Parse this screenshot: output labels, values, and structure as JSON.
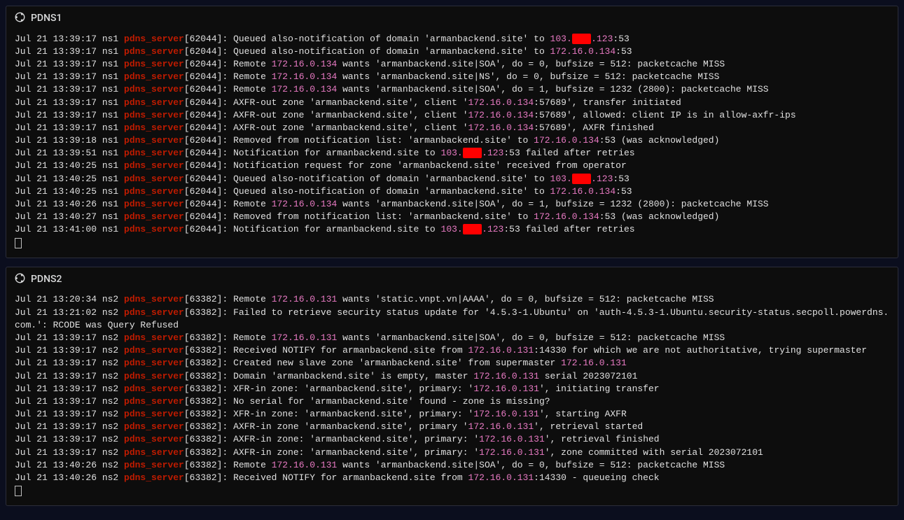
{
  "panel1": {
    "title": "PDNS1",
    "lines": [
      {
        "segments": [
          {
            "t": "Jul 21 13:39:17 ns1 ",
            "c": "ts"
          },
          {
            "t": "pdns_server",
            "c": "proc"
          },
          {
            "t": "[62044]: Queued also-notification of domain 'armanbackend.site' to ",
            "c": "pid"
          },
          {
            "t": "103.",
            "c": "ip"
          },
          {
            "t": "XXX",
            "c": "redact"
          },
          {
            "t": ".123",
            "c": "ip"
          },
          {
            "t": ":53",
            "c": "pid"
          }
        ]
      },
      {
        "segments": [
          {
            "t": "Jul 21 13:39:17 ns1 ",
            "c": "ts"
          },
          {
            "t": "pdns_server",
            "c": "proc"
          },
          {
            "t": "[62044]: Queued also-notification of domain 'armanbackend.site' to ",
            "c": "pid"
          },
          {
            "t": "172.16.0.134",
            "c": "ip"
          },
          {
            "t": ":53",
            "c": "pid"
          }
        ]
      },
      {
        "segments": [
          {
            "t": "Jul 21 13:39:17 ns1 ",
            "c": "ts"
          },
          {
            "t": "pdns_server",
            "c": "proc"
          },
          {
            "t": "[62044]: Remote ",
            "c": "pid"
          },
          {
            "t": "172.16.0.134",
            "c": "ip"
          },
          {
            "t": " wants 'armanbackend.site|SOA', do = 0, bufsize = 512: packetcache MISS",
            "c": "pid"
          }
        ]
      },
      {
        "segments": [
          {
            "t": "Jul 21 13:39:17 ns1 ",
            "c": "ts"
          },
          {
            "t": "pdns_server",
            "c": "proc"
          },
          {
            "t": "[62044]: Remote ",
            "c": "pid"
          },
          {
            "t": "172.16.0.134",
            "c": "ip"
          },
          {
            "t": " wants 'armanbackend.site|NS', do = 0, bufsize = 512: packetcache MISS",
            "c": "pid"
          }
        ]
      },
      {
        "segments": [
          {
            "t": "Jul 21 13:39:17 ns1 ",
            "c": "ts"
          },
          {
            "t": "pdns_server",
            "c": "proc"
          },
          {
            "t": "[62044]: Remote ",
            "c": "pid"
          },
          {
            "t": "172.16.0.134",
            "c": "ip"
          },
          {
            "t": " wants 'armanbackend.site|SOA', do = 1, bufsize = 1232 (2800): packetcache MISS",
            "c": "pid"
          }
        ]
      },
      {
        "segments": [
          {
            "t": "Jul 21 13:39:17 ns1 ",
            "c": "ts"
          },
          {
            "t": "pdns_server",
            "c": "proc"
          },
          {
            "t": "[62044]: AXFR-out zone 'armanbackend.site', client '",
            "c": "pid"
          },
          {
            "t": "172.16.0.134",
            "c": "ipq"
          },
          {
            "t": ":57689', transfer initiated",
            "c": "pid"
          }
        ]
      },
      {
        "segments": [
          {
            "t": "Jul 21 13:39:17 ns1 ",
            "c": "ts"
          },
          {
            "t": "pdns_server",
            "c": "proc"
          },
          {
            "t": "[62044]: AXFR-out zone 'armanbackend.site', client '",
            "c": "pid"
          },
          {
            "t": "172.16.0.134",
            "c": "ipq"
          },
          {
            "t": ":57689', allowed: client IP is in allow-axfr-ips",
            "c": "pid"
          }
        ]
      },
      {
        "segments": [
          {
            "t": "Jul 21 13:39:17 ns1 ",
            "c": "ts"
          },
          {
            "t": "pdns_server",
            "c": "proc"
          },
          {
            "t": "[62044]: AXFR-out zone 'armanbackend.site', client '",
            "c": "pid"
          },
          {
            "t": "172.16.0.134",
            "c": "ipq"
          },
          {
            "t": ":57689', AXFR finished",
            "c": "pid"
          }
        ]
      },
      {
        "segments": [
          {
            "t": "Jul 21 13:39:18 ns1 ",
            "c": "ts"
          },
          {
            "t": "pdns_server",
            "c": "proc"
          },
          {
            "t": "[62044]: Removed from notification list: 'armanbackend.site' to ",
            "c": "pid"
          },
          {
            "t": "172.16.0.134",
            "c": "ip"
          },
          {
            "t": ":53 (was acknowledged)",
            "c": "pid"
          }
        ]
      },
      {
        "segments": [
          {
            "t": "Jul 21 13:39:51 ns1 ",
            "c": "ts"
          },
          {
            "t": "pdns_server",
            "c": "proc"
          },
          {
            "t": "[62044]: Notification for armanbackend.site to ",
            "c": "pid"
          },
          {
            "t": "103.",
            "c": "ip"
          },
          {
            "t": "XXX",
            "c": "redact"
          },
          {
            "t": ".123",
            "c": "ip"
          },
          {
            "t": ":53 failed after retries",
            "c": "pid"
          }
        ]
      },
      {
        "segments": [
          {
            "t": "Jul 21 13:40:25 ns1 ",
            "c": "ts"
          },
          {
            "t": "pdns_server",
            "c": "proc"
          },
          {
            "t": "[62044]: Notification request for zone 'armanbackend.site' received from operator",
            "c": "pid"
          }
        ]
      },
      {
        "segments": [
          {
            "t": "Jul 21 13:40:25 ns1 ",
            "c": "ts"
          },
          {
            "t": "pdns_server",
            "c": "proc"
          },
          {
            "t": "[62044]: Queued also-notification of domain 'armanbackend.site' to ",
            "c": "pid"
          },
          {
            "t": "103.",
            "c": "ip"
          },
          {
            "t": "XXX",
            "c": "redact"
          },
          {
            "t": ".123",
            "c": "ip"
          },
          {
            "t": ":53",
            "c": "pid"
          }
        ]
      },
      {
        "segments": [
          {
            "t": "Jul 21 13:40:25 ns1 ",
            "c": "ts"
          },
          {
            "t": "pdns_server",
            "c": "proc"
          },
          {
            "t": "[62044]: Queued also-notification of domain 'armanbackend.site' to ",
            "c": "pid"
          },
          {
            "t": "172.16.0.134",
            "c": "ip"
          },
          {
            "t": ":53",
            "c": "pid"
          }
        ]
      },
      {
        "segments": [
          {
            "t": "Jul 21 13:40:26 ns1 ",
            "c": "ts"
          },
          {
            "t": "pdns_server",
            "c": "proc"
          },
          {
            "t": "[62044]: Remote ",
            "c": "pid"
          },
          {
            "t": "172.16.0.134",
            "c": "ip"
          },
          {
            "t": " wants 'armanbackend.site|SOA', do = 1, bufsize = 1232 (2800): packetcache MISS",
            "c": "pid"
          }
        ]
      },
      {
        "segments": [
          {
            "t": "Jul 21 13:40:27 ns1 ",
            "c": "ts"
          },
          {
            "t": "pdns_server",
            "c": "proc"
          },
          {
            "t": "[62044]: Removed from notification list: 'armanbackend.site' to ",
            "c": "pid"
          },
          {
            "t": "172.16.0.134",
            "c": "ip"
          },
          {
            "t": ":53 (was acknowledged)",
            "c": "pid"
          }
        ]
      },
      {
        "segments": [
          {
            "t": "Jul 21 13:41:00 ns1 ",
            "c": "ts"
          },
          {
            "t": "pdns_server",
            "c": "proc"
          },
          {
            "t": "[62044]: Notification for armanbackend.site to ",
            "c": "pid"
          },
          {
            "t": "103.",
            "c": "ip"
          },
          {
            "t": "XXX",
            "c": "redact"
          },
          {
            "t": ".123",
            "c": "ip"
          },
          {
            "t": ":53 failed after retries",
            "c": "pid"
          }
        ]
      }
    ]
  },
  "panel2": {
    "title": "PDNS2",
    "lines": [
      {
        "segments": [
          {
            "t": "Jul 21 13:20:34 ns2 ",
            "c": "ts"
          },
          {
            "t": "pdns_server",
            "c": "proc"
          },
          {
            "t": "[63382]: Remote ",
            "c": "pid"
          },
          {
            "t": "172.16.0.131",
            "c": "ip"
          },
          {
            "t": " wants 'static.vnpt.vn|AAAA', do = 0, bufsize = 512: packetcache MISS",
            "c": "pid"
          }
        ]
      },
      {
        "segments": [
          {
            "t": "Jul 21 13:21:02 ns2 ",
            "c": "ts"
          },
          {
            "t": "pdns_server",
            "c": "proc"
          },
          {
            "t": "[63382]: Failed to retrieve security status update for '4.5.3-1.Ubuntu' on 'auth-4.5.3-1.Ubuntu.security-status.secpoll.powerdns.com.': RCODE was Query Refused",
            "c": "pid"
          }
        ]
      },
      {
        "segments": [
          {
            "t": "Jul 21 13:39:17 ns2 ",
            "c": "ts"
          },
          {
            "t": "pdns_server",
            "c": "proc"
          },
          {
            "t": "[63382]: Remote ",
            "c": "pid"
          },
          {
            "t": "172.16.0.131",
            "c": "ip"
          },
          {
            "t": " wants 'armanbackend.site|SOA', do = 0, bufsize = 512: packetcache MISS",
            "c": "pid"
          }
        ]
      },
      {
        "segments": [
          {
            "t": "Jul 21 13:39:17 ns2 ",
            "c": "ts"
          },
          {
            "t": "pdns_server",
            "c": "proc"
          },
          {
            "t": "[63382]: Received NOTIFY for armanbackend.site from ",
            "c": "pid"
          },
          {
            "t": "172.16.0.131",
            "c": "ip"
          },
          {
            "t": ":14330 for which we are not authoritative, trying supermaster",
            "c": "pid"
          }
        ]
      },
      {
        "segments": [
          {
            "t": "Jul 21 13:39:17 ns2 ",
            "c": "ts"
          },
          {
            "t": "pdns_server",
            "c": "proc"
          },
          {
            "t": "[63382]: Created new slave zone 'armanbackend.site' from supermaster ",
            "c": "pid"
          },
          {
            "t": "172.16.0.131",
            "c": "ip"
          }
        ]
      },
      {
        "segments": [
          {
            "t": "Jul 21 13:39:17 ns2 ",
            "c": "ts"
          },
          {
            "t": "pdns_server",
            "c": "proc"
          },
          {
            "t": "[63382]: Domain 'armanbackend.site' is empty, master ",
            "c": "pid"
          },
          {
            "t": "172.16.0.131",
            "c": "ip"
          },
          {
            "t": " serial 2023072101",
            "c": "pid"
          }
        ]
      },
      {
        "segments": [
          {
            "t": "Jul 21 13:39:17 ns2 ",
            "c": "ts"
          },
          {
            "t": "pdns_server",
            "c": "proc"
          },
          {
            "t": "[63382]: XFR-in zone: 'armanbackend.site', primary: '",
            "c": "pid"
          },
          {
            "t": "172.16.0.131",
            "c": "ipq"
          },
          {
            "t": "', initiating transfer",
            "c": "pid"
          }
        ]
      },
      {
        "segments": [
          {
            "t": "Jul 21 13:39:17 ns2 ",
            "c": "ts"
          },
          {
            "t": "pdns_server",
            "c": "proc"
          },
          {
            "t": "[63382]: No serial for 'armanbackend.site' found - zone is missing?",
            "c": "pid"
          }
        ]
      },
      {
        "segments": [
          {
            "t": "Jul 21 13:39:17 ns2 ",
            "c": "ts"
          },
          {
            "t": "pdns_server",
            "c": "proc"
          },
          {
            "t": "[63382]: XFR-in zone: 'armanbackend.site', primary: '",
            "c": "pid"
          },
          {
            "t": "172.16.0.131",
            "c": "ipq"
          },
          {
            "t": "', starting AXFR",
            "c": "pid"
          }
        ]
      },
      {
        "segments": [
          {
            "t": "Jul 21 13:39:17 ns2 ",
            "c": "ts"
          },
          {
            "t": "pdns_server",
            "c": "proc"
          },
          {
            "t": "[63382]: AXFR-in zone 'armanbackend.site', primary '",
            "c": "pid"
          },
          {
            "t": "172.16.0.131",
            "c": "ipq"
          },
          {
            "t": "', retrieval started",
            "c": "pid"
          }
        ]
      },
      {
        "segments": [
          {
            "t": "Jul 21 13:39:17 ns2 ",
            "c": "ts"
          },
          {
            "t": "pdns_server",
            "c": "proc"
          },
          {
            "t": "[63382]: AXFR-in zone: 'armanbackend.site', primary: '",
            "c": "pid"
          },
          {
            "t": "172.16.0.131",
            "c": "ipq"
          },
          {
            "t": "', retrieval finished",
            "c": "pid"
          }
        ]
      },
      {
        "segments": [
          {
            "t": "Jul 21 13:39:17 ns2 ",
            "c": "ts"
          },
          {
            "t": "pdns_server",
            "c": "proc"
          },
          {
            "t": "[63382]: AXFR-in zone: 'armanbackend.site', primary: '",
            "c": "pid"
          },
          {
            "t": "172.16.0.131",
            "c": "ipq"
          },
          {
            "t": "', zone committed with serial 2023072101",
            "c": "pid"
          }
        ]
      },
      {
        "segments": [
          {
            "t": "Jul 21 13:40:26 ns2 ",
            "c": "ts"
          },
          {
            "t": "pdns_server",
            "c": "proc"
          },
          {
            "t": "[63382]: Remote ",
            "c": "pid"
          },
          {
            "t": "172.16.0.131",
            "c": "ip"
          },
          {
            "t": " wants 'armanbackend.site|SOA', do = 0, bufsize = 512: packetcache MISS",
            "c": "pid"
          }
        ]
      },
      {
        "segments": [
          {
            "t": "Jul 21 13:40:26 ns2 ",
            "c": "ts"
          },
          {
            "t": "pdns_server",
            "c": "proc"
          },
          {
            "t": "[63382]: Received NOTIFY for armanbackend.site from ",
            "c": "pid"
          },
          {
            "t": "172.16.0.131",
            "c": "ip"
          },
          {
            "t": ":14330 - queueing check",
            "c": "pid"
          }
        ]
      }
    ]
  }
}
